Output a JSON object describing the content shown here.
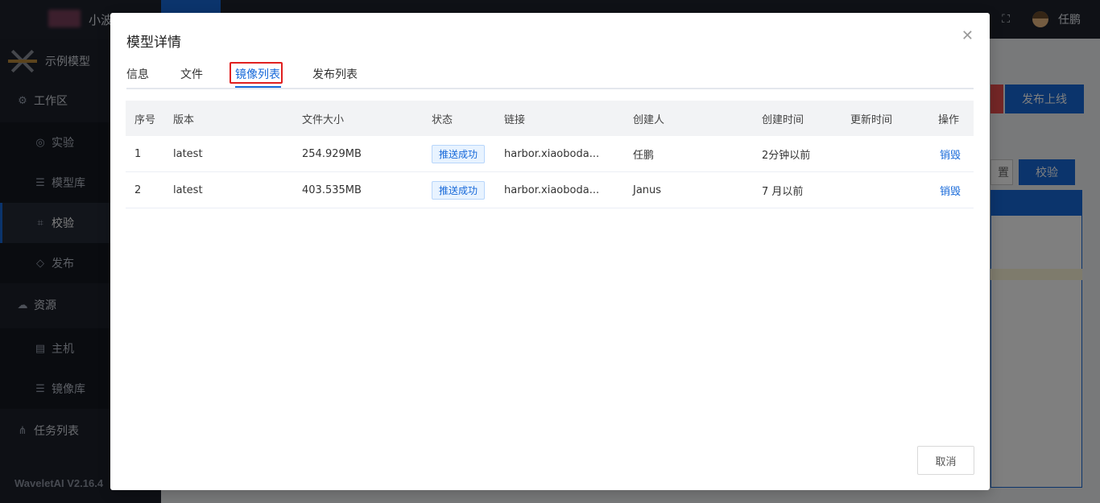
{
  "app": {
    "brand_text": "小波",
    "user_name": "任鹏",
    "version": "WaveletAI V2.16.4",
    "fullscreen_icon": "fullscreen-icon"
  },
  "sidebar": {
    "logo_label": "示例模型",
    "items": [
      {
        "label": "工作区",
        "icon": "gear-icon",
        "type": "section"
      },
      {
        "label": "实验",
        "icon": "experiment-icon",
        "type": "sub"
      },
      {
        "label": "模型库",
        "icon": "database-icon",
        "type": "sub"
      },
      {
        "label": "校验",
        "icon": "scan-icon",
        "type": "sub",
        "selected": true
      },
      {
        "label": "发布",
        "icon": "cube-icon",
        "type": "sub"
      },
      {
        "label": "资源",
        "icon": "cloud-icon",
        "type": "section"
      },
      {
        "label": "主机",
        "icon": "server-icon",
        "type": "sub"
      },
      {
        "label": "镜像库",
        "icon": "database-icon",
        "type": "sub"
      },
      {
        "label": "任务列表",
        "icon": "share-icon",
        "type": "section"
      }
    ]
  },
  "background": {
    "publish_button": "发布上线",
    "reset_button_partial": "置",
    "verify_button": "校验"
  },
  "modal": {
    "title": "模型详情",
    "close_icon": "close-icon",
    "tabs": [
      "信息",
      "文件",
      "镜像列表",
      "发布列表"
    ],
    "active_tab": "镜像列表",
    "table": {
      "columns": [
        "序号",
        "版本",
        "文件大小",
        "状态",
        "链接",
        "创建人",
        "创建时间",
        "更新时间",
        "操作"
      ],
      "rows": [
        {
          "index": "1",
          "version": "latest",
          "size": "254.929MB",
          "status": "推送成功",
          "link": "harbor.xiaoboda...",
          "creator": "任鹏",
          "created": "2分钟以前",
          "updated": "",
          "action": "销毁"
        },
        {
          "index": "2",
          "version": "latest",
          "size": "403.535MB",
          "status": "推送成功",
          "link": "harbor.xiaoboda...",
          "creator": "Janus",
          "created": "7 月以前",
          "updated": "",
          "action": "销毁"
        }
      ]
    },
    "cancel_button": "取消"
  },
  "colors": {
    "accent": "#1769d9",
    "highlight_border": "#e02020",
    "sidebar_bg": "#1c202b"
  }
}
